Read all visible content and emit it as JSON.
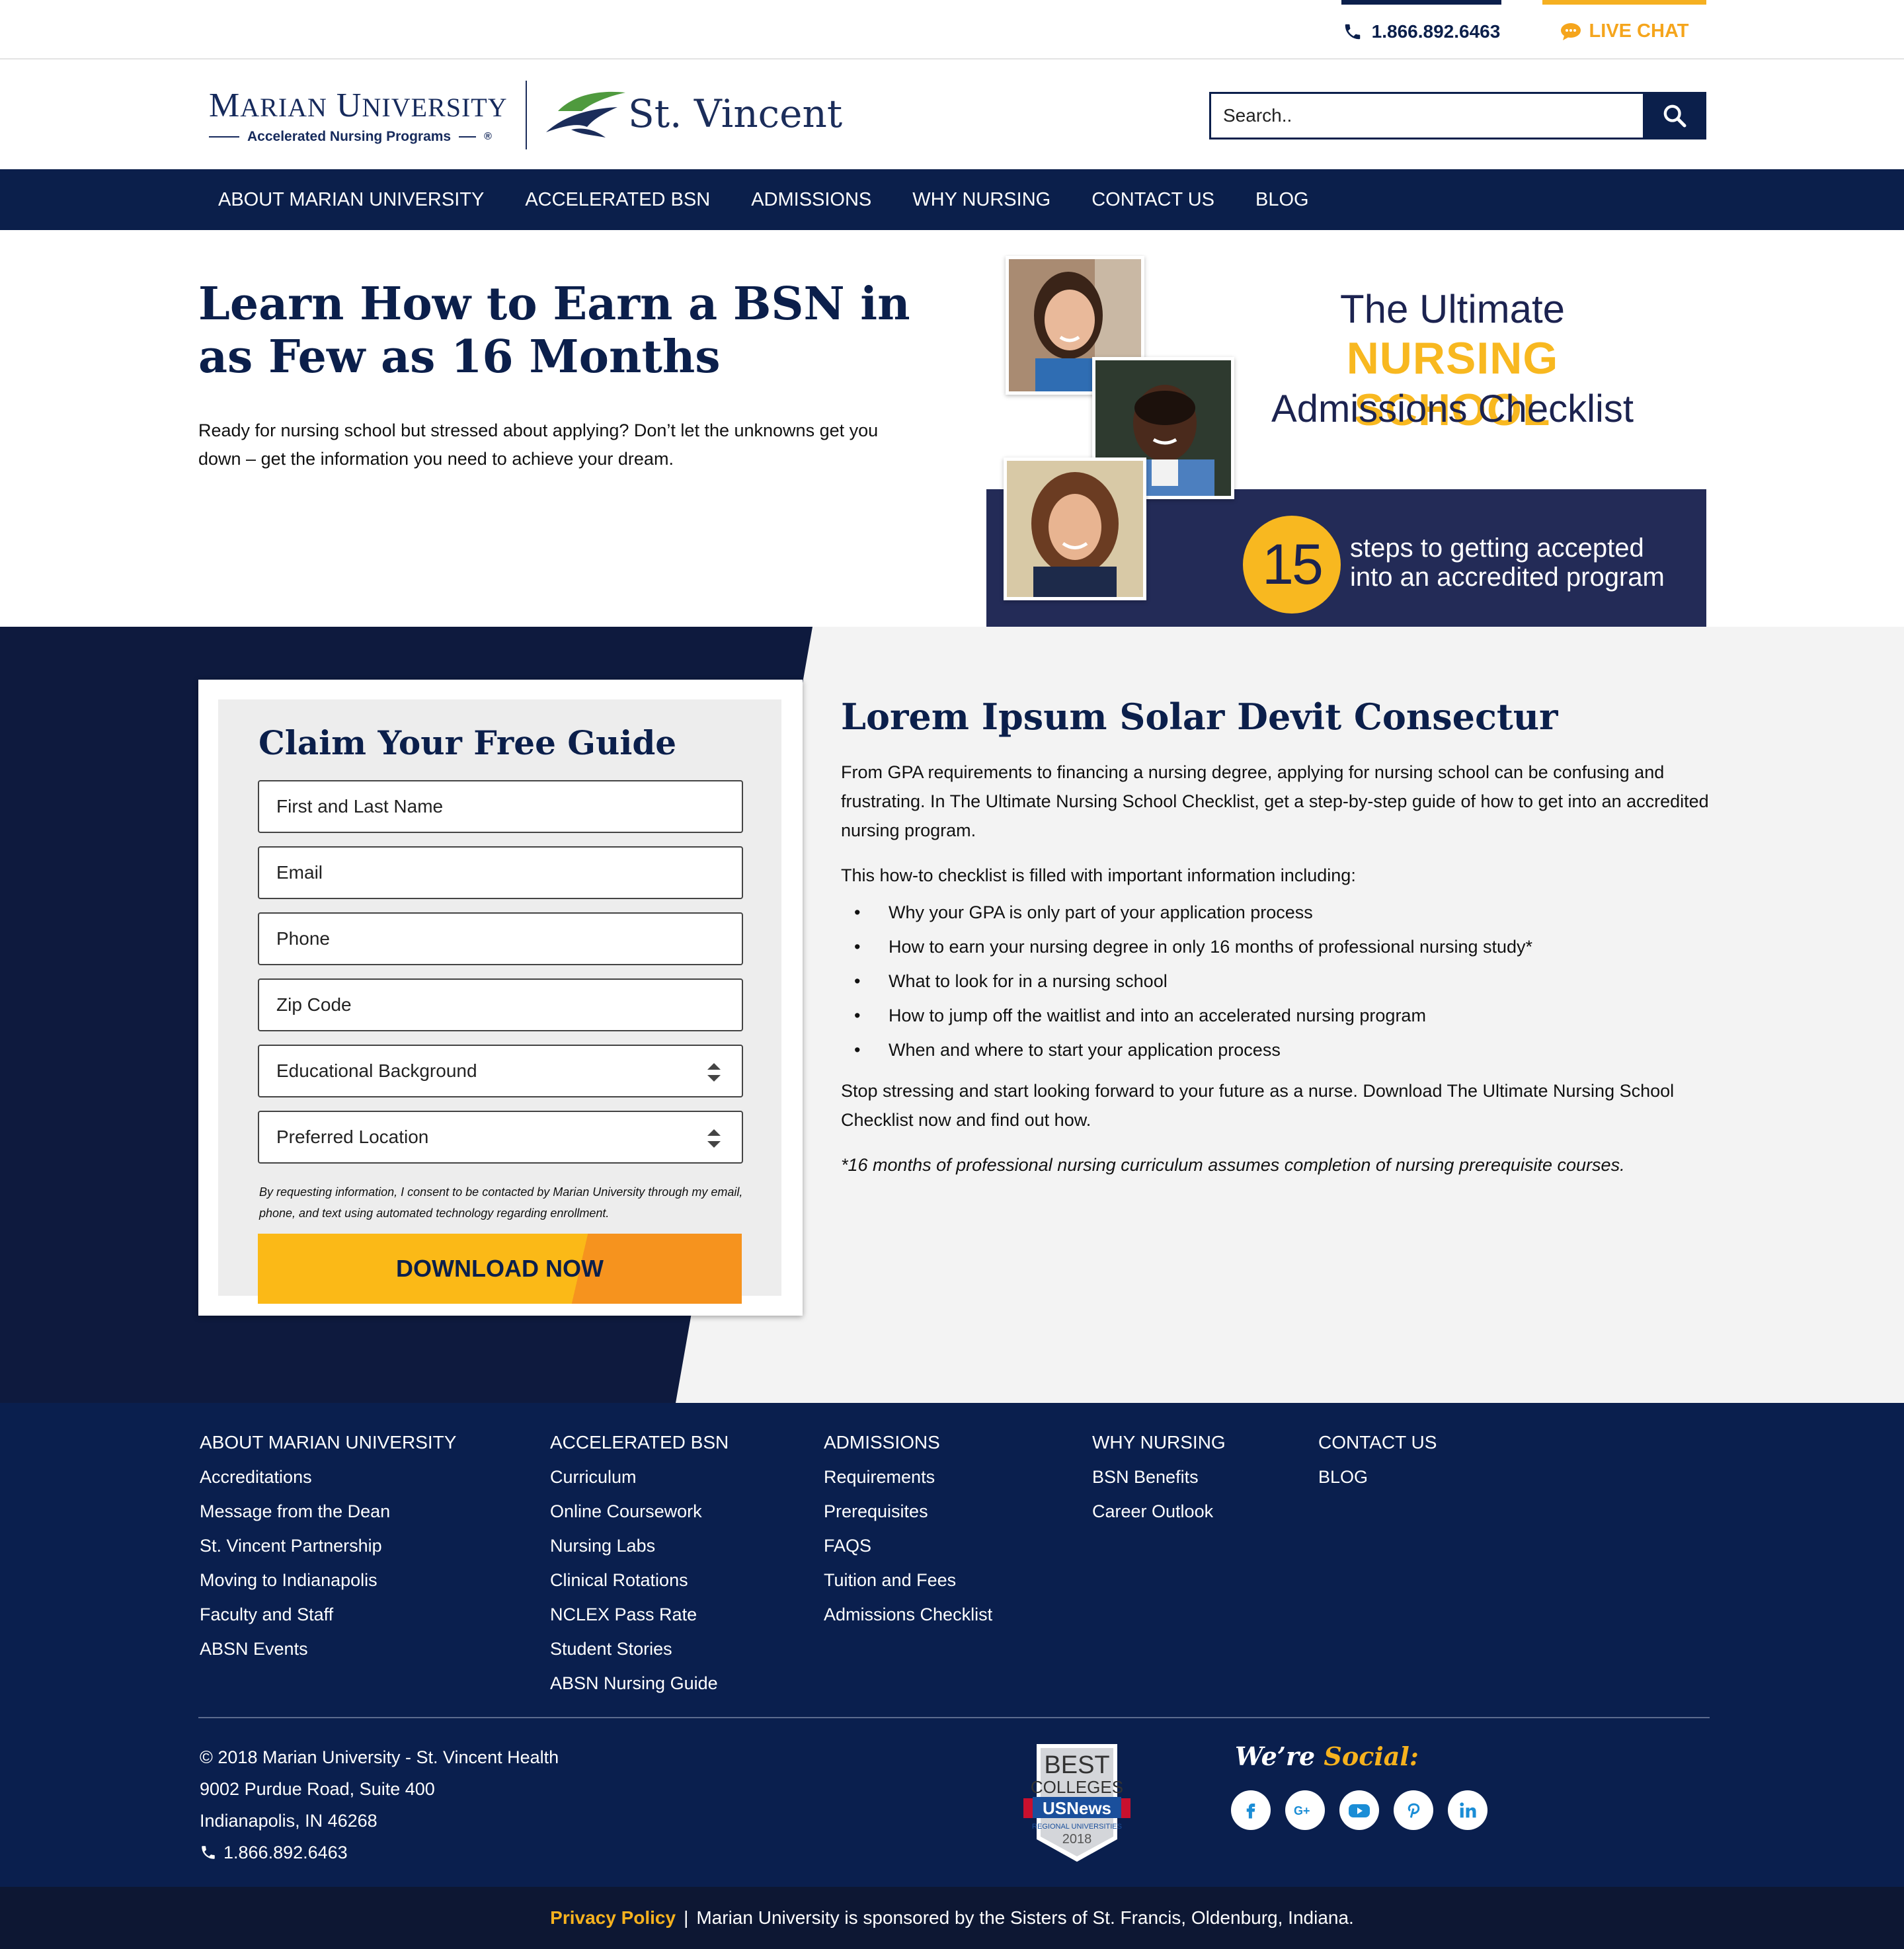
{
  "topbar": {
    "phone": "1.866.892.6463",
    "live_chat": "LIVE CHAT"
  },
  "header": {
    "logo_marian_name": "Marian University",
    "logo_marian_sub": "Accelerated Nursing Programs",
    "logo_sv": "St. Vincent",
    "search_placeholder": "Search.."
  },
  "nav": {
    "items": [
      "ABOUT MARIAN UNIVERSITY",
      "ACCELERATED BSN",
      "ADMISSIONS",
      "WHY NURSING",
      "CONTACT US",
      "BLOG"
    ]
  },
  "hero": {
    "title": "Learn How to Earn a BSN in as Few as 16 Months",
    "text": "Ready for nursing school but stressed about applying? Don’t let the unknowns get you down – get the information you need to achieve your dream.",
    "banner": {
      "line1": "The Ultimate",
      "line2": "NURSING SCHOOL",
      "line3": "Admissions Checklist",
      "number": "15",
      "steps": "steps to getting accepted into an accredited program"
    }
  },
  "form": {
    "title": "Claim Your Free Guide",
    "fields": [
      "First and Last Name",
      "Email",
      "Phone",
      "Zip Code"
    ],
    "selects": [
      "Educational Background",
      "Preferred Location"
    ],
    "consent": "By requesting information, I consent to be contacted by Marian University through my email, phone, and text using automated technology regarding enrollment.",
    "button": "DOWNLOAD NOW"
  },
  "content": {
    "heading": "Lorem Ipsum Solar Devit Consectur",
    "p1": "From GPA requirements to financing a nursing degree, applying for nursing school can be confusing and frustrating. In The Ultimate Nursing School Checklist, get a step-by-step guide of how to get into an accredited nursing program.",
    "p2": "This how-to checklist is filled with important information including:",
    "bullets": [
      "Why your GPA is only part of your application process",
      "How to earn your nursing degree in only 16 months of professional nursing study*",
      "What to look for in a nursing school",
      "How to jump off the waitlist and into an accelerated nursing program",
      "When and where to start your application process"
    ],
    "p3": "Stop stressing and start looking forward to your future as a nurse. Download The Ultimate Nursing School Checklist now and find out how.",
    "note": "*16 months of professional nursing curriculum assumes completion of nursing prerequisite courses."
  },
  "footer": {
    "columns": [
      {
        "head": "ABOUT MARIAN UNIVERSITY",
        "links": [
          "Accreditations",
          "Message from the Dean",
          "St. Vincent Partnership",
          "Moving to Indianapolis",
          "Faculty and Staff",
          "ABSN Events"
        ]
      },
      {
        "head": "ACCELERATED BSN",
        "links": [
          "Curriculum",
          "Online Coursework",
          "Nursing Labs",
          "Clinical Rotations",
          "NCLEX Pass Rate",
          "Student Stories",
          "ABSN Nursing Guide"
        ]
      },
      {
        "head": "ADMISSIONS",
        "links": [
          "Requirements",
          "Prerequisites",
          "FAQS",
          "Tuition and Fees",
          "Admissions Checklist"
        ]
      },
      {
        "head": "WHY NURSING",
        "links": [
          "BSN Benefits",
          "Career Outlook"
        ]
      },
      {
        "head": "CONTACT US",
        "links": [
          "BLOG"
        ]
      }
    ],
    "address": [
      "© 2018 Marian University - St. Vincent Health",
      "9002 Purdue Road, Suite 400",
      "Indianapolis, IN 46268"
    ],
    "phone": "1.866.892.6463",
    "badge": {
      "line1": "BEST",
      "line2": "COLLEGES",
      "line3": "USNews",
      "line4": "REGIONAL UNIVERSITIES",
      "year": "2018"
    },
    "social_prefix": "We’re",
    "social_word": "Social:",
    "social_icons": [
      "facebook-icon",
      "google-plus-icon",
      "youtube-icon",
      "pinterest-icon",
      "linkedin-icon"
    ]
  },
  "bottombar": {
    "privacy": "Privacy Policy",
    "separator": "|",
    "sponsor": "Marian University is sponsored by the Sisters of St. Francis, Oldenburg, Indiana."
  },
  "colors": {
    "navy": "#0b1f4b",
    "gold": "#f8b820",
    "orange": "#f6931e",
    "footer": "#0a1f4e"
  }
}
